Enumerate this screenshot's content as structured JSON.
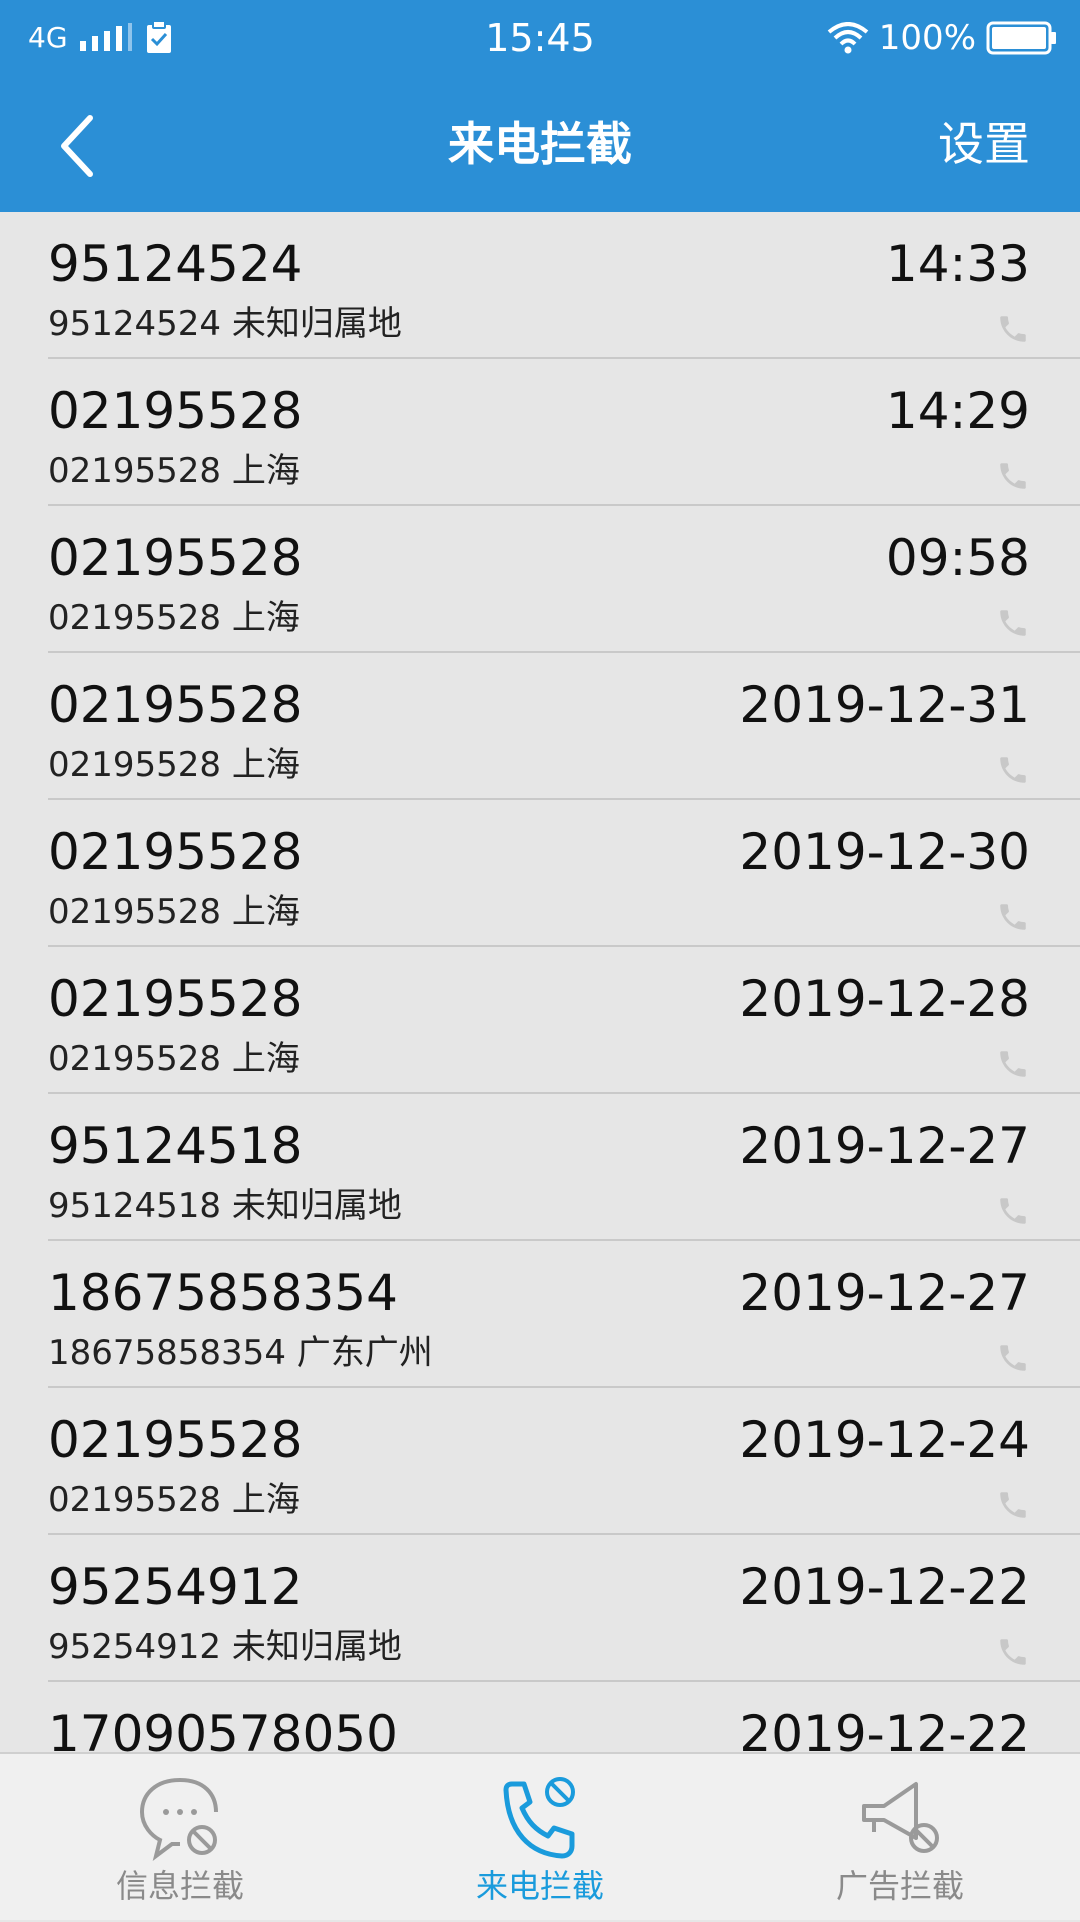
{
  "status_bar": {
    "network": "4G",
    "time": "15:45",
    "battery": "100%"
  },
  "header": {
    "title": "来电拦截",
    "settings_label": "设置"
  },
  "calls": [
    {
      "number": "95124524",
      "detail": "95124524 未知归属地",
      "time": "14:33"
    },
    {
      "number": "02195528",
      "detail": "02195528 上海",
      "time": "14:29"
    },
    {
      "number": "02195528",
      "detail": "02195528 上海",
      "time": "09:58"
    },
    {
      "number": "02195528",
      "detail": "02195528 上海",
      "time": "2019-12-31"
    },
    {
      "number": "02195528",
      "detail": "02195528 上海",
      "time": "2019-12-30"
    },
    {
      "number": "02195528",
      "detail": "02195528 上海",
      "time": "2019-12-28"
    },
    {
      "number": "95124518",
      "detail": "95124518 未知归属地",
      "time": "2019-12-27"
    },
    {
      "number": "18675858354",
      "detail": "18675858354 广东广州",
      "time": "2019-12-27"
    },
    {
      "number": "02195528",
      "detail": "02195528 上海",
      "time": "2019-12-24"
    },
    {
      "number": "95254912",
      "detail": "95254912 未知归属地",
      "time": "2019-12-22"
    },
    {
      "number": "17090578050",
      "detail": "",
      "time": "2019-12-22"
    }
  ],
  "bottom_nav": [
    {
      "label": "信息拦截",
      "icon": "message-block-icon"
    },
    {
      "label": "来电拦截",
      "icon": "call-block-icon",
      "active": true
    },
    {
      "label": "广告拦截",
      "icon": "ad-block-icon"
    }
  ],
  "colors": {
    "header_bg": "#2b8fd6",
    "active_tab": "#1a9bdc",
    "inactive_tab": "#8a8a8a"
  }
}
